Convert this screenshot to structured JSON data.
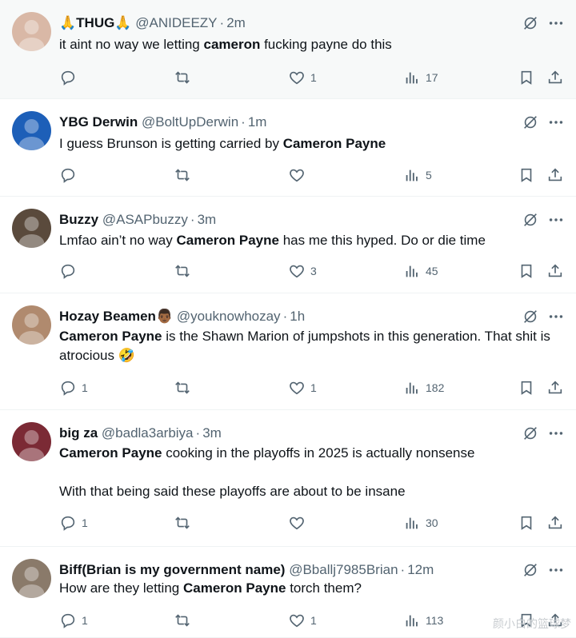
{
  "tweets": [
    {
      "name": "🙏THUG🙏",
      "handle": "@ANIDEEZY",
      "time": "2m",
      "body": [
        [
          "it aint no way we letting ",
          "cameron",
          " fucking ",
          "payne",
          " do this"
        ]
      ],
      "replies": "",
      "likes": "1",
      "views": "17",
      "avatar_color": "#d9b8a6"
    },
    {
      "name": "YBG Derwin",
      "handle": "@BoltUpDerwin",
      "time": "1m",
      "body": [
        [
          "I guess Brunson is getting carried by ",
          "Cameron Payne",
          ""
        ]
      ],
      "replies": "",
      "likes": "",
      "views": "5",
      "avatar_color": "#1d5fb8"
    },
    {
      "name": "Buzzy",
      "handle": "@ASAPbuzzy",
      "time": "3m",
      "body": [
        [
          "Lmfao ain’t no way ",
          "Cameron Payne",
          " has me this hyped. Do or die time"
        ]
      ],
      "replies": "",
      "likes": "3",
      "views": "45",
      "avatar_color": "#5a4a3c"
    },
    {
      "name": "Hozay Beamen",
      "name_emoji": "👨🏾",
      "handle": "@youknowhozay",
      "time": "1h",
      "body": [
        [
          "",
          "Cameron Payne",
          " is the Shawn Marion of jumpshots in this generation. That shit is atrocious 🤣"
        ]
      ],
      "replies": "1",
      "likes": "1",
      "views": "182",
      "avatar_color": "#b08a6e"
    },
    {
      "name": "big za",
      "handle": "@badla3arbiya",
      "time": "3m",
      "body": [
        [
          "",
          "Cameron Payne",
          " cooking in the playoffs in 2025 is actually nonsense"
        ],
        [
          "With that being said these playoffs are about to be insane",
          "",
          ""
        ]
      ],
      "replies": "1",
      "likes": "",
      "views": "30",
      "avatar_color": "#7b2a35"
    },
    {
      "name": "Biff(Brian is my government name)",
      "handle": "@Bballj7985Brian",
      "time": "12m",
      "body": [
        [
          "How are they letting ",
          "Cameron Payne",
          " torch them?"
        ]
      ],
      "replies": "1",
      "likes": "1",
      "views": "113",
      "avatar_color": "#8a7a6a"
    }
  ],
  "watermark": "颜小白的篮球梦"
}
